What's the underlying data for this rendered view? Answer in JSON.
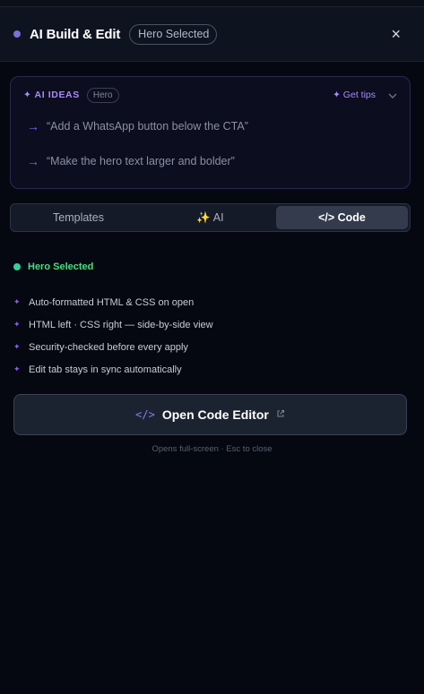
{
  "header": {
    "title": "AI Build & Edit",
    "badge": "Hero Selected",
    "close_glyph": "×"
  },
  "ideas": {
    "label": "✦ AI IDEAS",
    "section_pill": "Hero",
    "tips_label": "✦ Get tips",
    "items": [
      "“Add a WhatsApp button below the CTA”",
      "“Make the hero text larger and bolder”"
    ]
  },
  "tabs": [
    {
      "label": "Templates",
      "active": false
    },
    {
      "label": "✨ AI",
      "active": false
    },
    {
      "label": "</> Code",
      "active": true
    }
  ],
  "status": {
    "text": "Hero Selected",
    "color": "#2fd39a"
  },
  "features": [
    "Auto-formatted HTML & CSS on open",
    "HTML left · CSS right — side-by-side view",
    "Security-checked before every apply",
    "Edit tab stays in sync automatically"
  ],
  "open_editor": {
    "label": "Open Code Editor",
    "hint": "Opens full-screen · Esc to close"
  },
  "colors": {
    "accent": "#8b5cf6",
    "background": "#050810",
    "success": "#4ade80"
  }
}
